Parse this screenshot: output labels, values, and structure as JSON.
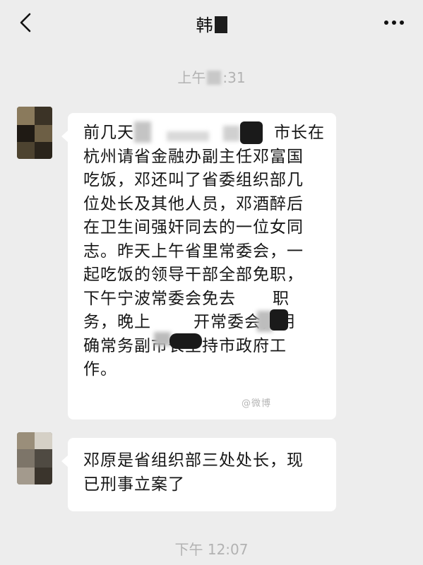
{
  "header": {
    "title": "韩",
    "back_icon": "chevron-left-icon",
    "more_icon": "more-dots-icon"
  },
  "timestamps": {
    "first_prefix": "上午",
    "first_suffix": ":31",
    "second": "下午 12:07"
  },
  "messages": [
    {
      "lines": [
        "前几天",
        "杭州请省金融办副主任邓富国",
        "吃饭，邓还叫了省委组织部几",
        "位处长及其他人员，邓酒醉后",
        "在卫生间强奸同去的一位女同",
        "志。昨天上午省里常委会，一",
        "起吃饭的领导干部全部免职，",
        "下午宁波常委会免去",
        "务，晚上",
        "确常务副市长主持市政府工",
        "作。"
      ],
      "line1_tail": "市长在",
      "line8_tail": "职",
      "line9_tail": "开常委会，明"
    },
    {
      "lines": [
        "邓原是省组织部三处处长，现",
        "已刑事立案了"
      ]
    }
  ],
  "watermark": "@微博",
  "colors": {
    "background": "#ededed",
    "bubble": "#ffffff",
    "text": "#161616",
    "timestamp": "#b2b2b2"
  }
}
